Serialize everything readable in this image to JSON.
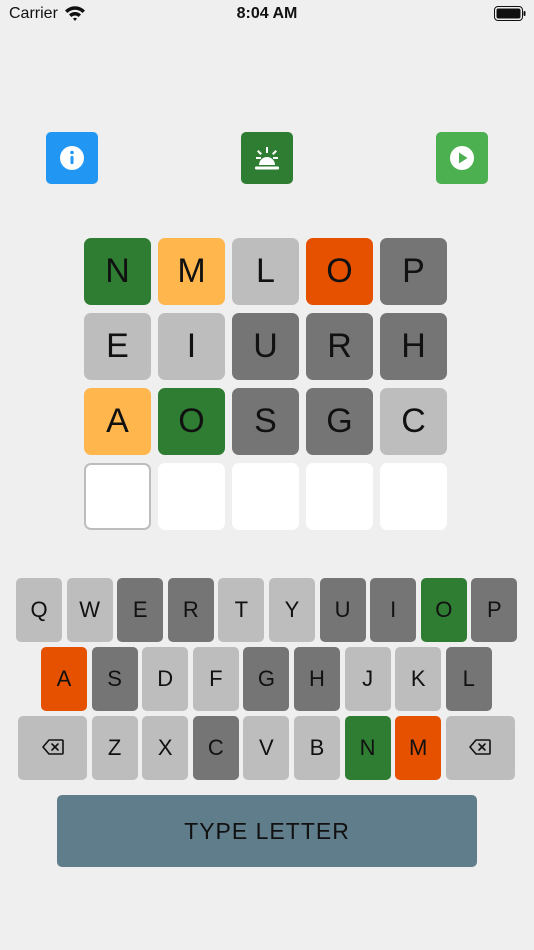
{
  "status_bar": {
    "carrier": "Carrier",
    "time": "8:04 AM"
  },
  "toolbar": [
    {
      "name": "info-button",
      "icon": "info-icon",
      "color": "#2196f3"
    },
    {
      "name": "alarm-button",
      "icon": "alarm-light-icon",
      "color": "#2e7d32"
    },
    {
      "name": "play-button",
      "icon": "play-icon",
      "color": "#4caf50"
    }
  ],
  "colors": {
    "correct": "#2e7d32",
    "present": "#ffb74d",
    "absent": "#757575",
    "unknown": "#bdbdbd",
    "orange": "#e65100"
  },
  "grid": [
    [
      {
        "letter": "N",
        "state": "correct"
      },
      {
        "letter": "M",
        "state": "present"
      },
      {
        "letter": "L",
        "state": "unknown"
      },
      {
        "letter": "O",
        "state": "orange"
      },
      {
        "letter": "P",
        "state": "absent"
      }
    ],
    [
      {
        "letter": "E",
        "state": "unknown"
      },
      {
        "letter": "I",
        "state": "unknown"
      },
      {
        "letter": "U",
        "state": "absent"
      },
      {
        "letter": "R",
        "state": "absent"
      },
      {
        "letter": "H",
        "state": "absent"
      }
    ],
    [
      {
        "letter": "A",
        "state": "present"
      },
      {
        "letter": "O",
        "state": "correct"
      },
      {
        "letter": "S",
        "state": "absent"
      },
      {
        "letter": "G",
        "state": "absent"
      },
      {
        "letter": "C",
        "state": "unknown"
      }
    ],
    [
      {
        "letter": "",
        "state": "active"
      },
      {
        "letter": "",
        "state": "empty"
      },
      {
        "letter": "",
        "state": "empty"
      },
      {
        "letter": "",
        "state": "empty"
      },
      {
        "letter": "",
        "state": "empty"
      }
    ]
  ],
  "keyboard": {
    "row1": [
      {
        "label": "Q",
        "state": "unknown"
      },
      {
        "label": "W",
        "state": "unknown"
      },
      {
        "label": "E",
        "state": "absent"
      },
      {
        "label": "R",
        "state": "absent"
      },
      {
        "label": "T",
        "state": "unknown"
      },
      {
        "label": "Y",
        "state": "unknown"
      },
      {
        "label": "U",
        "state": "absent"
      },
      {
        "label": "I",
        "state": "absent"
      },
      {
        "label": "O",
        "state": "correct"
      },
      {
        "label": "P",
        "state": "absent"
      }
    ],
    "row2": [
      {
        "label": "A",
        "state": "orange"
      },
      {
        "label": "S",
        "state": "absent"
      },
      {
        "label": "D",
        "state": "unknown"
      },
      {
        "label": "F",
        "state": "unknown"
      },
      {
        "label": "G",
        "state": "absent"
      },
      {
        "label": "H",
        "state": "absent"
      },
      {
        "label": "J",
        "state": "unknown"
      },
      {
        "label": "K",
        "state": "unknown"
      },
      {
        "label": "L",
        "state": "absent"
      }
    ],
    "row3": [
      {
        "label": "",
        "icon": "backspace-icon",
        "state": "unknown",
        "wide": true
      },
      {
        "label": "Z",
        "state": "unknown"
      },
      {
        "label": "X",
        "state": "unknown"
      },
      {
        "label": "C",
        "state": "absent"
      },
      {
        "label": "V",
        "state": "unknown"
      },
      {
        "label": "B",
        "state": "unknown"
      },
      {
        "label": "N",
        "state": "correct"
      },
      {
        "label": "M",
        "state": "orange"
      },
      {
        "label": "",
        "icon": "backspace-icon",
        "state": "unknown",
        "wide": true
      }
    ]
  },
  "action": {
    "type_letter_label": "TYPE LETTER"
  }
}
